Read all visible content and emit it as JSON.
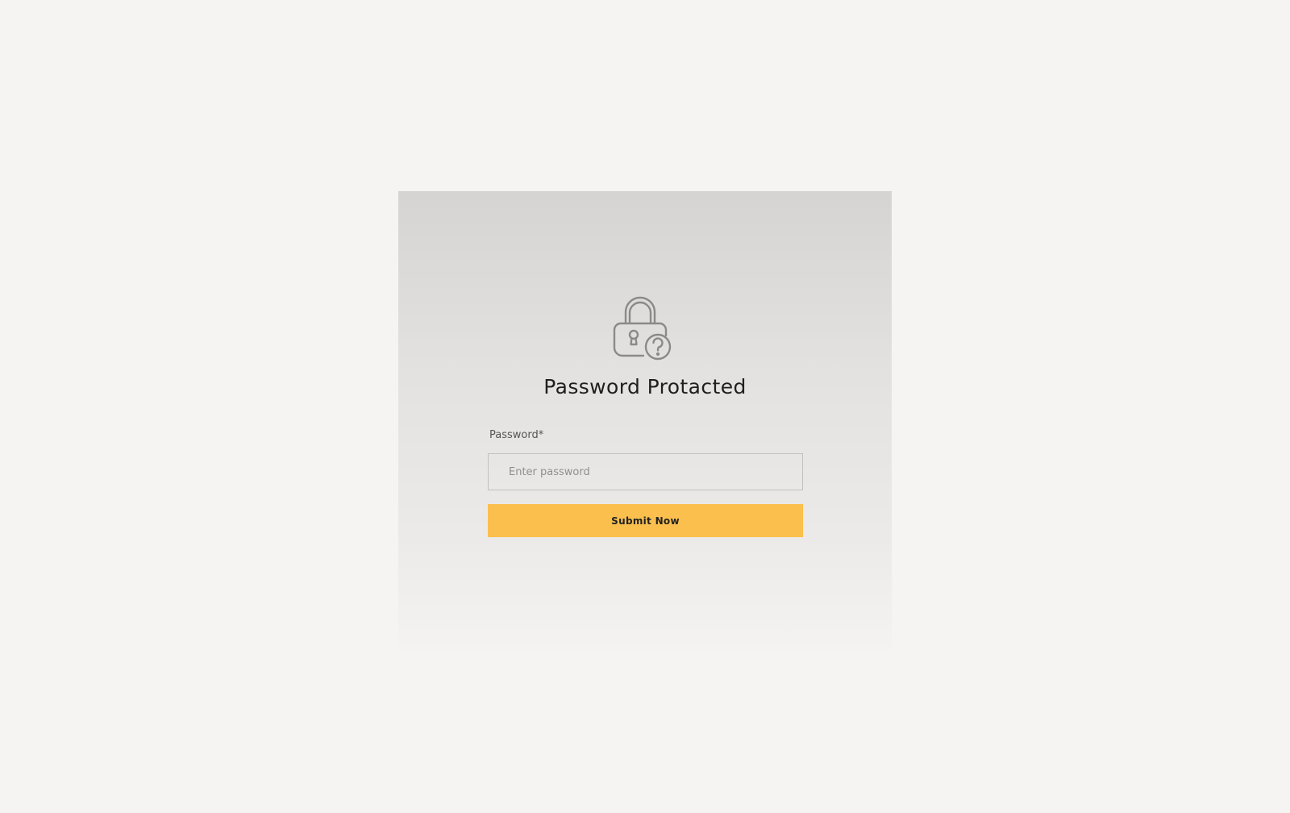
{
  "colors": {
    "background": "#f5f4f2",
    "accent": "#fbbf4d",
    "icon_stroke": "#8a8a8a"
  },
  "dialog": {
    "icon": "lock-question-icon",
    "title": "Password Protacted",
    "password_label": "Password*",
    "password_placeholder": "Enter password",
    "password_value": "",
    "submit_label": "Submit Now"
  }
}
